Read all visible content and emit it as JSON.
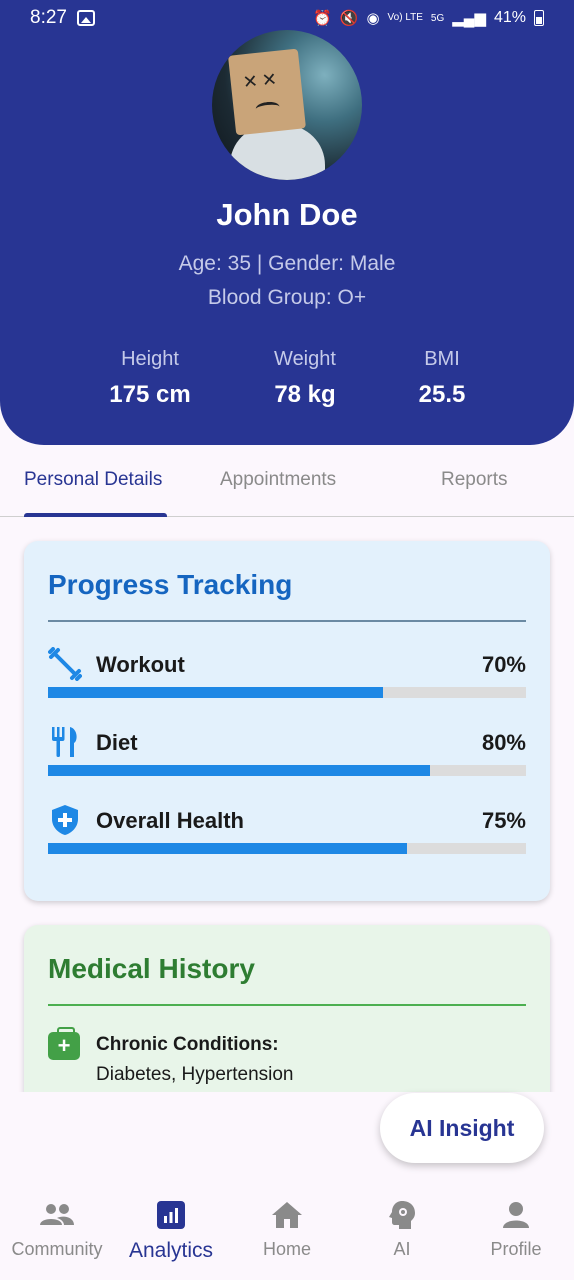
{
  "status_bar": {
    "time": "8:27",
    "network": "Vo) LTE",
    "gen": "5G",
    "battery": "41%"
  },
  "profile": {
    "name": "John Doe",
    "age_gender": "Age: 35 | Gender: Male",
    "blood_group": "Blood Group: O+",
    "stats": [
      {
        "label": "Height",
        "value": "175 cm"
      },
      {
        "label": "Weight",
        "value": "78 kg"
      },
      {
        "label": "BMI",
        "value": "25.5"
      }
    ]
  },
  "tabs": [
    {
      "label": "Personal Details",
      "active": true
    },
    {
      "label": "Appointments",
      "active": false
    },
    {
      "label": "Reports",
      "active": false
    }
  ],
  "progress": {
    "title": "Progress Tracking",
    "accent": "#1e88e5",
    "items": [
      {
        "label": "Workout",
        "percent_text": "70%",
        "value": 0.7,
        "icon": "dumbbell-icon"
      },
      {
        "label": "Diet",
        "percent_text": "80%",
        "value": 0.8,
        "icon": "restaurant-icon"
      },
      {
        "label": "Overall Health",
        "percent_text": "75%",
        "value": 0.75,
        "icon": "health-shield-icon"
      }
    ]
  },
  "medical": {
    "title": "Medical History",
    "items": [
      {
        "label": "Chronic Conditions:",
        "value": "Diabetes, Hypertension",
        "icon": "medical-bag-icon"
      }
    ]
  },
  "fab": {
    "label": "AI Insight"
  },
  "nav": [
    {
      "label": "Community",
      "icon": "people-icon",
      "active": false
    },
    {
      "label": "Analytics",
      "icon": "analytics-icon",
      "active": true
    },
    {
      "label": "Home",
      "icon": "home-icon",
      "active": false
    },
    {
      "label": "AI",
      "icon": "ai-brain-icon",
      "active": false
    },
    {
      "label": "Profile",
      "icon": "person-icon",
      "active": false
    }
  ],
  "colors": {
    "primary": "#283593",
    "progress_card": "#e3f1fc",
    "medical_card": "#e8f5e9",
    "medical_title": "#2e7d32"
  }
}
